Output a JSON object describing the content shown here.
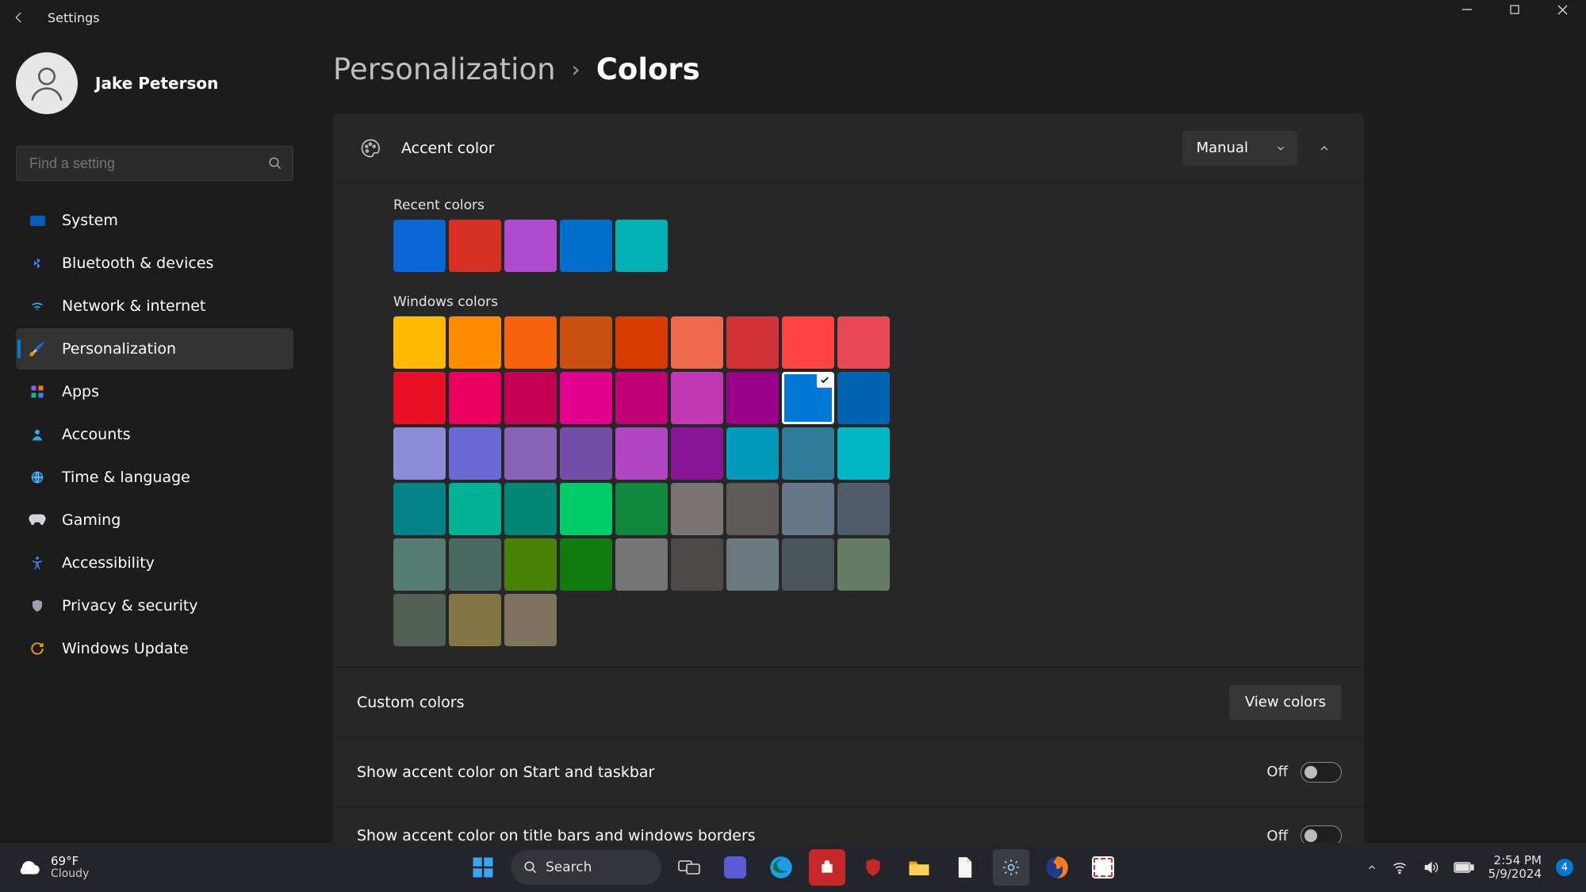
{
  "window": {
    "app_title": "Settings"
  },
  "user": {
    "display_name": "Jake Peterson"
  },
  "search": {
    "placeholder": "Find a setting"
  },
  "sidebar": {
    "items": [
      {
        "label": "System",
        "icon": "monitor",
        "active": false
      },
      {
        "label": "Bluetooth & devices",
        "icon": "bluetooth",
        "active": false
      },
      {
        "label": "Network & internet",
        "icon": "wifi",
        "active": false
      },
      {
        "label": "Personalization",
        "icon": "paint",
        "active": true
      },
      {
        "label": "Apps",
        "icon": "apps",
        "active": false
      },
      {
        "label": "Accounts",
        "icon": "person",
        "active": false
      },
      {
        "label": "Time & language",
        "icon": "globe",
        "active": false
      },
      {
        "label": "Gaming",
        "icon": "gamepad",
        "active": false
      },
      {
        "label": "Accessibility",
        "icon": "a11y",
        "active": false
      },
      {
        "label": "Privacy & security",
        "icon": "shield",
        "active": false
      },
      {
        "label": "Windows Update",
        "icon": "sync",
        "active": false
      }
    ]
  },
  "breadcrumb": {
    "parent": "Personalization",
    "page": "Colors"
  },
  "accent": {
    "header_label": "Accent color",
    "mode_label": "Manual",
    "recent_label": "Recent colors",
    "recent_colors": [
      "#0a66d6",
      "#d93025",
      "#b04bd0",
      "#006ccc",
      "#00b0b3"
    ],
    "windows_label": "Windows colors",
    "windows_colors": [
      "#ffb900",
      "#ff8c00",
      "#f7630c",
      "#ca5010",
      "#da3b01",
      "#ef6950",
      "#d13438",
      "#ff4343",
      "#e74856",
      "#e81123",
      "#ea005e",
      "#c30052",
      "#e3008c",
      "#bf0077",
      "#c239b3",
      "#9a0089",
      "#0078d7",
      "#0063b1",
      "#8e8cd8",
      "#6b69d6",
      "#8764b8",
      "#744da9",
      "#b146c2",
      "#881798",
      "#0099bc",
      "#2d7d9a",
      "#00b7c3",
      "#038387",
      "#00b294",
      "#018574",
      "#00cc6a",
      "#10893e",
      "#7a7574",
      "#5d5a58",
      "#68768a",
      "#515c6b",
      "#567c73",
      "#486860",
      "#498205",
      "#107c10",
      "#767676",
      "#4c4a48",
      "#69797e",
      "#4a5459",
      "#647c64",
      "#525e54",
      "#847545",
      "#7e735f"
    ],
    "selected_color": "#0078d7"
  },
  "custom": {
    "label": "Custom colors",
    "button": "View colors"
  },
  "options": [
    {
      "label": "Show accent color on Start and taskbar",
      "state": "Off"
    },
    {
      "label": "Show accent color on title bars and windows borders",
      "state": "Off"
    }
  ],
  "taskbar": {
    "weather_temp": "69°F",
    "weather_cond": "Cloudy",
    "search_label": "Search",
    "time": "2:54 PM",
    "date": "5/9/2024",
    "notification_count": "4"
  }
}
